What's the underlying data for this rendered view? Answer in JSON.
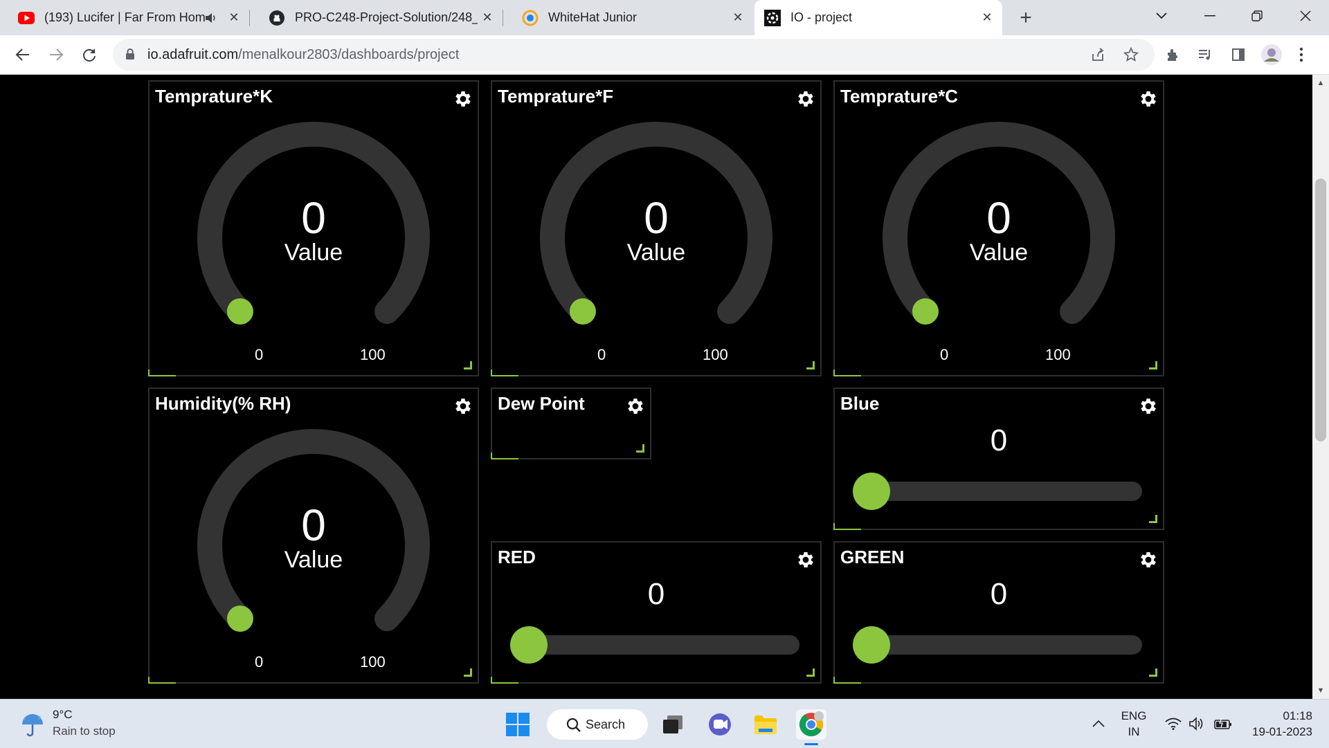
{
  "browser": {
    "tabs": [
      {
        "title": "(193) Lucifer | Far From Home",
        "favicon": "youtube-icon",
        "audio": true
      },
      {
        "title": "PRO-C248-Project-Solution/248_",
        "favicon": "github-icon"
      },
      {
        "title": "WhiteHat Junior",
        "favicon": "whitehat-icon"
      },
      {
        "title": "IO - project",
        "favicon": "adafruit-io-icon",
        "active": true
      }
    ],
    "url_host": "io.adafruit.com",
    "url_path": "/menalkour2803/dashboards/project"
  },
  "dashboard": {
    "accent_color": "#8cc63f",
    "gauges": [
      {
        "title": "Temprature*K",
        "value": "0",
        "label": "Value",
        "min": "0",
        "max": "100",
        "fraction": 0
      },
      {
        "title": "Temprature*F",
        "value": "0",
        "label": "Value",
        "min": "0",
        "max": "100",
        "fraction": 0
      },
      {
        "title": "Temprature*C",
        "value": "0",
        "label": "Value",
        "min": "0",
        "max": "100",
        "fraction": 0
      },
      {
        "title": "Humidity(% RH)",
        "value": "0",
        "label": "Value",
        "min": "0",
        "max": "100",
        "fraction": 0
      }
    ],
    "text_block": {
      "title": "Dew Point"
    },
    "sliders": [
      {
        "title": "Blue",
        "value": "0",
        "fraction": 0
      },
      {
        "title": "RED",
        "value": "0",
        "fraction": 0
      },
      {
        "title": "GREEN",
        "value": "0",
        "fraction": 0
      }
    ]
  },
  "taskbar": {
    "weather_temp": "9°C",
    "weather_desc": "Rain to stop",
    "search_label": "Search",
    "lang_line1": "ENG",
    "lang_line2": "IN",
    "time": "01:18",
    "date": "19-01-2023"
  }
}
